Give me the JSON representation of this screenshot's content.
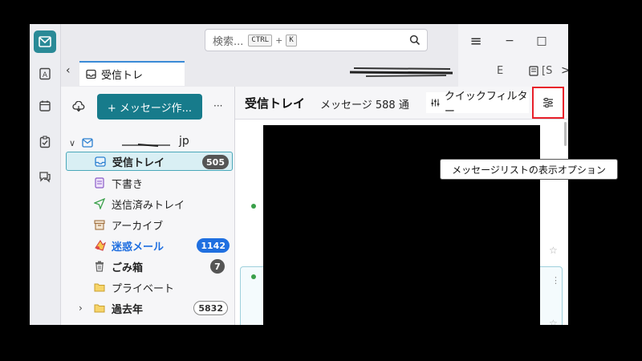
{
  "search": {
    "placeholder": "検索...",
    "shortcut_key1": "CTRL",
    "shortcut_plus": "+",
    "shortcut_key2": "K"
  },
  "window": {
    "menu_glyph": "≡",
    "minimize_glyph": "−",
    "maximize_glyph": "□",
    "close_glyph": "✕"
  },
  "tabs": {
    "active_label": "受信トレ",
    "right_partial1": "E",
    "right_partial2": "[S",
    "next_glyph": ">",
    "list_glyph": "∨"
  },
  "folder_pane": {
    "compose_label": "+ メッセージ作...",
    "more_label": "···",
    "account": {
      "name_prefix": "",
      "name_suffix": "jp"
    },
    "folders": [
      {
        "name": "受信トレイ",
        "badge": "505"
      },
      {
        "name": "下書き",
        "badge": ""
      },
      {
        "name": "送信済みトレイ",
        "badge": ""
      },
      {
        "name": "アーカイブ",
        "badge": ""
      },
      {
        "name": "迷惑メール",
        "badge": "1142"
      },
      {
        "name": "ごみ箱",
        "badge": "7"
      },
      {
        "name": "プライベート",
        "badge": ""
      },
      {
        "name": "過去年",
        "badge": "5832"
      }
    ]
  },
  "message_pane": {
    "title": "受信トレイ",
    "count_text": "メッセージ 588 通",
    "quick_filter_label": "クイックフィルター",
    "view_options_tooltip": "メッセージリストの表示オプション"
  },
  "colors": {
    "accent": "#177b8b",
    "highlight_border": "#e8202a",
    "junk_badge": "#1f6fe0"
  }
}
